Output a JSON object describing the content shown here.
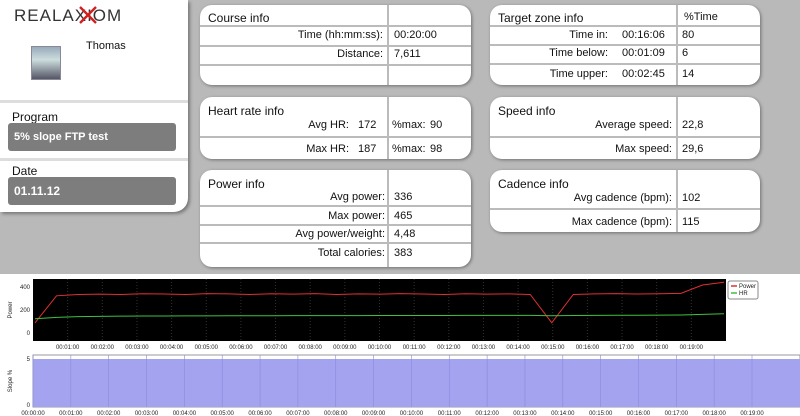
{
  "app": {
    "logo_text": "REALAXIOM"
  },
  "user": {
    "name": "Thomas"
  },
  "program": {
    "title": "Program",
    "value": "5% slope FTP test"
  },
  "date": {
    "title": "Date",
    "value": "01.11.12"
  },
  "course_info": {
    "title": "Course info",
    "rows": [
      {
        "label": "Time (hh:mm:ss):",
        "value": "00:20:00"
      },
      {
        "label": "Distance:",
        "value": "7,611"
      }
    ]
  },
  "heart_rate_info": {
    "title": "Heart rate info",
    "rows": [
      {
        "label": "Avg HR:",
        "value": "172",
        "pct_label": "%max:",
        "pct_value": "90"
      },
      {
        "label": "Max HR:",
        "value": "187",
        "pct_label": "%max:",
        "pct_value": "98"
      }
    ]
  },
  "power_info": {
    "title": "Power info",
    "rows": [
      {
        "label": "Avg power:",
        "value": "336"
      },
      {
        "label": "Max power:",
        "value": "465"
      },
      {
        "label": "Avg power/weight:",
        "value": "4,48"
      },
      {
        "label": "Total calories:",
        "value": "383"
      }
    ]
  },
  "target_zone_info": {
    "title": "Target zone info",
    "col_header": "%Time",
    "rows": [
      {
        "label": "Time in:",
        "value": "00:16:06",
        "pct": "80"
      },
      {
        "label": "Time below:",
        "value": "00:01:09",
        "pct": "6"
      },
      {
        "label": "Time upper:",
        "value": "00:02:45",
        "pct": "14"
      }
    ]
  },
  "speed_info": {
    "title": "Speed info",
    "rows": [
      {
        "label": "Average speed:",
        "value": "22,8"
      },
      {
        "label": "Max speed:",
        "value": "29,6"
      }
    ]
  },
  "cadence_info": {
    "title": "Cadence info",
    "rows": [
      {
        "label": "Avg cadence (bpm):",
        "value": "102"
      },
      {
        "label": "Max cadence (bpm):",
        "value": "115"
      }
    ]
  },
  "chart_data": [
    {
      "type": "line",
      "ylabel": "Power",
      "yticks": [
        "400",
        "200",
        "0"
      ],
      "ylim": [
        0,
        400
      ],
      "xticks": [
        "00:01:00",
        "00:02:00",
        "00:03:00",
        "00:04:00",
        "00:05:00",
        "00:06:00",
        "00:07:00",
        "00:08:00",
        "00:09:00",
        "00:10:00",
        "00:11:00",
        "00:12:00",
        "00:13:00",
        "00:14:00",
        "00:15:00",
        "00:16:00",
        "00:17:00",
        "00:18:00",
        "00:19:00"
      ],
      "legend": [
        "Power",
        "HR"
      ],
      "legend_position": "top-right",
      "series": [
        {
          "name": "Power",
          "color": "#e03030",
          "values": [
            120,
            320,
            330,
            332,
            330,
            335,
            333,
            330,
            336,
            334,
            330,
            335,
            332,
            336,
            330,
            334,
            332,
            336,
            333,
            330,
            335,
            332,
            334,
            330,
            120,
            330,
            334,
            336,
            333,
            335,
            338,
            400,
            420
          ]
        },
        {
          "name": "HR",
          "color": "#40c040",
          "values": [
            150,
            160,
            166,
            168,
            169,
            170,
            170,
            171,
            171,
            172,
            172,
            172,
            173,
            173,
            173,
            173,
            174,
            174,
            174,
            174,
            175,
            175,
            175,
            175,
            172,
            174,
            175,
            176,
            176,
            177,
            178,
            182,
            187
          ]
        }
      ]
    },
    {
      "type": "area",
      "ylabel": "Slope %",
      "yticks": [
        "5",
        "0"
      ],
      "ylim": [
        0,
        5
      ],
      "xticks": [
        "00:00:00",
        "00:01:00",
        "00:02:00",
        "00:03:00",
        "00:04:00",
        "00:05:00",
        "00:06:00",
        "00:07:00",
        "00:08:00",
        "00:09:00",
        "00:10:00",
        "00:11:00",
        "00:12:00",
        "00:13:00",
        "00:14:00",
        "00:15:00",
        "00:16:00",
        "00:17:00",
        "00:18:00",
        "00:19:00"
      ],
      "series": [
        {
          "name": "Slope",
          "color": "#a3a3f0",
          "values": [
            5,
            5
          ]
        }
      ]
    }
  ]
}
